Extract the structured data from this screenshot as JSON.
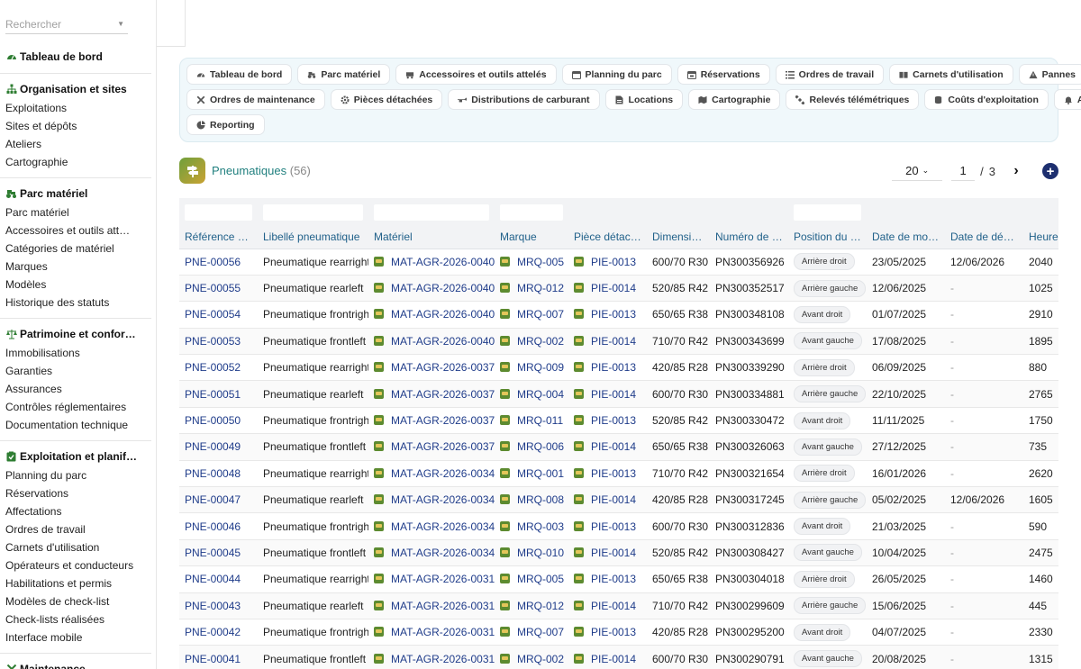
{
  "sidebar": {
    "search_placeholder": "Rechercher",
    "sections": [
      {
        "title": "Tableau de bord",
        "icon": "dashboard-icon",
        "items": []
      },
      {
        "title": "Organisation et sites",
        "icon": "org-chart-icon",
        "items": [
          "Exploitations",
          "Sites et dépôts",
          "Ateliers",
          "Cartographie"
        ]
      },
      {
        "title": "Parc matériel",
        "icon": "tractor-icon",
        "items": [
          "Parc matériel",
          "Accessoires et outils attel…",
          "Catégories de matériel",
          "Marques",
          "Modèles",
          "Historique des statuts"
        ]
      },
      {
        "title": "Patrimoine et confor…",
        "icon": "scales-icon",
        "items": [
          "Immobilisations",
          "Garanties",
          "Assurances",
          "Contrôles réglementaires",
          "Documentation technique"
        ]
      },
      {
        "title": "Exploitation et planif…",
        "icon": "clipboard-check-icon",
        "items": [
          "Planning du parc",
          "Réservations",
          "Affectations",
          "Ordres de travail",
          "Carnets d'utilisation",
          "Opérateurs et conducteurs",
          "Habilitations et permis",
          "Modèles de check-list",
          "Check-lists réalisées",
          "Interface mobile"
        ]
      },
      {
        "title": "Maintenance",
        "icon": "tools-icon",
        "items": []
      }
    ]
  },
  "toolbar": {
    "rows": [
      [
        {
          "label": "Tableau de bord",
          "icon": "dashboard-icon"
        },
        {
          "label": "Parc matériel",
          "icon": "tractor-icon"
        },
        {
          "label": "Accessoires et outils attelés",
          "icon": "trailer-icon"
        },
        {
          "label": "Planning du parc",
          "icon": "calendar-icon"
        },
        {
          "label": "Réservations",
          "icon": "calendar-check-icon"
        },
        {
          "label": "Ordres de travail",
          "icon": "list-icon"
        },
        {
          "label": "Carnets d'utilisation",
          "icon": "book-icon"
        },
        {
          "label": "Pannes",
          "icon": "warning-icon"
        }
      ],
      [
        {
          "label": "Ordres de maintenance",
          "icon": "tools-icon"
        },
        {
          "label": "Pièces détachées",
          "icon": "gear-icon"
        },
        {
          "label": "Distributions de carburant",
          "icon": "fuel-icon"
        },
        {
          "label": "Locations",
          "icon": "document-icon"
        },
        {
          "label": "Cartographie",
          "icon": "map-icon"
        },
        {
          "label": "Relevés télémétriques",
          "icon": "satellite-icon"
        },
        {
          "label": "Coûts d'exploitation",
          "icon": "coins-icon"
        },
        {
          "label": "Alertes",
          "icon": "bell-icon"
        }
      ],
      [
        {
          "label": "Reporting",
          "icon": "pie-chart-icon"
        }
      ]
    ]
  },
  "page": {
    "title": "Pneumatiques",
    "count": "(56)",
    "per_page": "20",
    "current_page": "1",
    "page_sep": "/",
    "total_pages": "3"
  },
  "table": {
    "headers": [
      "Référence p…",
      "Libellé pneumatique",
      "Matériel",
      "Marque",
      "Pièce détach…",
      "Dimensions",
      "Numéro de s…",
      "Position du p…",
      "Date de mon…",
      "Date de dép…",
      "Heures"
    ],
    "rows": [
      {
        "ref": "PNE-00056",
        "label": "Pneumatique rearright",
        "materiel": "MAT-AGR-2026-0040",
        "marque": "MRQ-005",
        "piece": "PIE-0013",
        "dim": "600/70 R30",
        "serial": "PN300356926",
        "position": "Arrière droit",
        "date_mon": "23/05/2025",
        "date_dep": "12/06/2026",
        "heures": "2040"
      },
      {
        "ref": "PNE-00055",
        "label": "Pneumatique rearleft",
        "materiel": "MAT-AGR-2026-0040",
        "marque": "MRQ-012",
        "piece": "PIE-0014",
        "dim": "520/85 R42",
        "serial": "PN300352517",
        "position": "Arrière gauche",
        "date_mon": "12/06/2025",
        "date_dep": "-",
        "heures": "1025"
      },
      {
        "ref": "PNE-00054",
        "label": "Pneumatique frontright",
        "materiel": "MAT-AGR-2026-0040",
        "marque": "MRQ-007",
        "piece": "PIE-0013",
        "dim": "650/65 R38",
        "serial": "PN300348108",
        "position": "Avant droit",
        "date_mon": "01/07/2025",
        "date_dep": "-",
        "heures": "2910"
      },
      {
        "ref": "PNE-00053",
        "label": "Pneumatique frontleft",
        "materiel": "MAT-AGR-2026-0040",
        "marque": "MRQ-002",
        "piece": "PIE-0014",
        "dim": "710/70 R42",
        "serial": "PN300343699",
        "position": "Avant gauche",
        "date_mon": "17/08/2025",
        "date_dep": "-",
        "heures": "1895"
      },
      {
        "ref": "PNE-00052",
        "label": "Pneumatique rearright",
        "materiel": "MAT-AGR-2026-0037",
        "marque": "MRQ-009",
        "piece": "PIE-0013",
        "dim": "420/85 R28",
        "serial": "PN300339290",
        "position": "Arrière droit",
        "date_mon": "06/09/2025",
        "date_dep": "-",
        "heures": "880"
      },
      {
        "ref": "PNE-00051",
        "label": "Pneumatique rearleft",
        "materiel": "MAT-AGR-2026-0037",
        "marque": "MRQ-004",
        "piece": "PIE-0014",
        "dim": "600/70 R30",
        "serial": "PN300334881",
        "position": "Arrière gauche",
        "date_mon": "22/10/2025",
        "date_dep": "-",
        "heures": "2765"
      },
      {
        "ref": "PNE-00050",
        "label": "Pneumatique frontright",
        "materiel": "MAT-AGR-2026-0037",
        "marque": "MRQ-011",
        "piece": "PIE-0013",
        "dim": "520/85 R42",
        "serial": "PN300330472",
        "position": "Avant droit",
        "date_mon": "11/11/2025",
        "date_dep": "-",
        "heures": "1750"
      },
      {
        "ref": "PNE-00049",
        "label": "Pneumatique frontleft",
        "materiel": "MAT-AGR-2026-0037",
        "marque": "MRQ-006",
        "piece": "PIE-0014",
        "dim": "650/65 R38",
        "serial": "PN300326063",
        "position": "Avant gauche",
        "date_mon": "27/12/2025",
        "date_dep": "-",
        "heures": "735"
      },
      {
        "ref": "PNE-00048",
        "label": "Pneumatique rearright",
        "materiel": "MAT-AGR-2026-0034",
        "marque": "MRQ-001",
        "piece": "PIE-0013",
        "dim": "710/70 R42",
        "serial": "PN300321654",
        "position": "Arrière droit",
        "date_mon": "16/01/2026",
        "date_dep": "-",
        "heures": "2620"
      },
      {
        "ref": "PNE-00047",
        "label": "Pneumatique rearleft",
        "materiel": "MAT-AGR-2026-0034",
        "marque": "MRQ-008",
        "piece": "PIE-0014",
        "dim": "420/85 R28",
        "serial": "PN300317245",
        "position": "Arrière gauche",
        "date_mon": "05/02/2025",
        "date_dep": "12/06/2026",
        "heures": "1605"
      },
      {
        "ref": "PNE-00046",
        "label": "Pneumatique frontright",
        "materiel": "MAT-AGR-2026-0034",
        "marque": "MRQ-003",
        "piece": "PIE-0013",
        "dim": "600/70 R30",
        "serial": "PN300312836",
        "position": "Avant droit",
        "date_mon": "21/03/2025",
        "date_dep": "-",
        "heures": "590"
      },
      {
        "ref": "PNE-00045",
        "label": "Pneumatique frontleft",
        "materiel": "MAT-AGR-2026-0034",
        "marque": "MRQ-010",
        "piece": "PIE-0014",
        "dim": "520/85 R42",
        "serial": "PN300308427",
        "position": "Avant gauche",
        "date_mon": "10/04/2025",
        "date_dep": "-",
        "heures": "2475"
      },
      {
        "ref": "PNE-00044",
        "label": "Pneumatique rearright",
        "materiel": "MAT-AGR-2026-0031",
        "marque": "MRQ-005",
        "piece": "PIE-0013",
        "dim": "650/65 R38",
        "serial": "PN300304018",
        "position": "Arrière droit",
        "date_mon": "26/05/2025",
        "date_dep": "-",
        "heures": "1460"
      },
      {
        "ref": "PNE-00043",
        "label": "Pneumatique rearleft",
        "materiel": "MAT-AGR-2026-0031",
        "marque": "MRQ-012",
        "piece": "PIE-0014",
        "dim": "710/70 R42",
        "serial": "PN300299609",
        "position": "Arrière gauche",
        "date_mon": "15/06/2025",
        "date_dep": "-",
        "heures": "445"
      },
      {
        "ref": "PNE-00042",
        "label": "Pneumatique frontright",
        "materiel": "MAT-AGR-2026-0031",
        "marque": "MRQ-007",
        "piece": "PIE-0013",
        "dim": "420/85 R28",
        "serial": "PN300295200",
        "position": "Avant droit",
        "date_mon": "04/07/2025",
        "date_dep": "-",
        "heures": "2330"
      },
      {
        "ref": "PNE-00041",
        "label": "Pneumatique frontleft",
        "materiel": "MAT-AGR-2026-0031",
        "marque": "MRQ-002",
        "piece": "PIE-0014",
        "dim": "600/70 R30",
        "serial": "PN300290791",
        "position": "Avant gauche",
        "date_mon": "20/08/2025",
        "date_dep": "-",
        "heures": "1315"
      }
    ]
  },
  "colors": {
    "accent_teal": "#21807f",
    "link_blue": "#1f3c8a",
    "add_button": "#1d2f6f",
    "sidebar_icon_green": "#2e7d32"
  }
}
